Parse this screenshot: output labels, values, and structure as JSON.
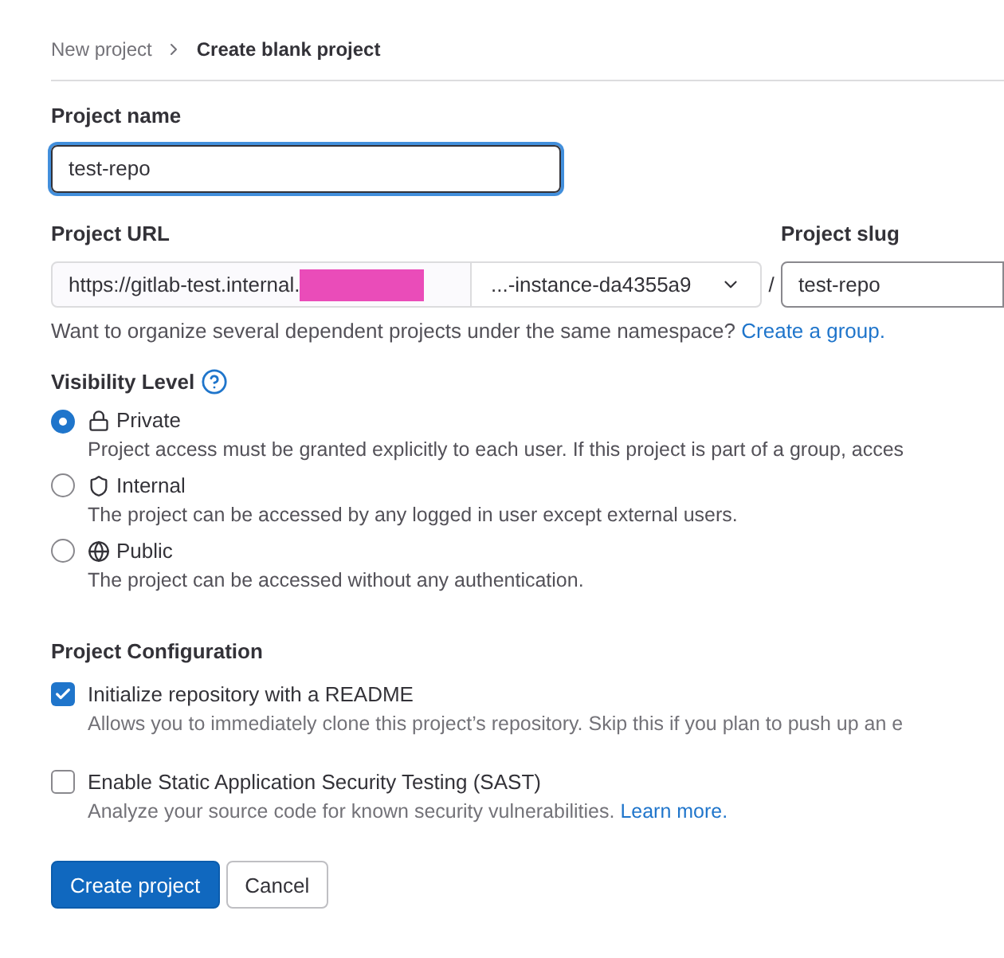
{
  "breadcrumb": [
    {
      "label": "New project",
      "current": false
    },
    {
      "label": "Create blank project",
      "current": true
    }
  ],
  "project_name": {
    "label": "Project name",
    "value": "test-repo"
  },
  "project_url": {
    "label": "Project URL",
    "prefix": "https://gitlab-test.internal.",
    "namespace": "...-instance-da4355a9",
    "separator": "/"
  },
  "project_slug": {
    "label": "Project slug",
    "value": "test-repo"
  },
  "namespace_help": {
    "text": "Want to organize several dependent projects under the same namespace?",
    "link": "Create a group."
  },
  "visibility": {
    "label": "Visibility Level",
    "options": [
      {
        "kind": "lock",
        "label": "Private",
        "description": "Project access must be granted explicitly to each user. If this project is part of a group, acces",
        "selected": true
      },
      {
        "kind": "shield",
        "label": "Internal",
        "description": "The project can be accessed by any logged in user except external users.",
        "selected": false
      },
      {
        "kind": "globe",
        "label": "Public",
        "description": "The project can be accessed without any authentication.",
        "selected": false
      }
    ]
  },
  "configuration": {
    "label": "Project Configuration",
    "options": [
      {
        "label": "Initialize repository with a README",
        "description": "Allows you to immediately clone this project’s repository. Skip this if you plan to push up an e",
        "checked": true
      },
      {
        "label": "Enable Static Application Security Testing (SAST)",
        "description": "Analyze your source code for known security vulnerabilities.",
        "link": "Learn more.",
        "checked": false
      }
    ]
  },
  "buttons": [
    {
      "kind": "primary",
      "label": "Create project"
    },
    {
      "kind": "secondary",
      "label": "Cancel"
    }
  ]
}
